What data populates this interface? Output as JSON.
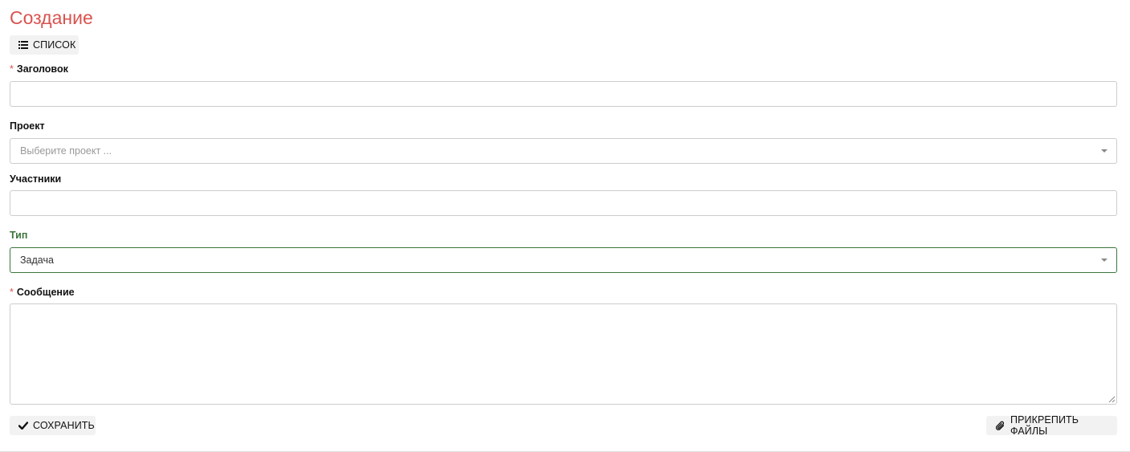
{
  "page": {
    "title": "Создание"
  },
  "toolbar": {
    "list_label": "СПИСОК",
    "list_icon": "list-icon"
  },
  "form": {
    "title_field": {
      "label": "Заголовок",
      "required_mark": "*",
      "value": ""
    },
    "project_field": {
      "label": "Проект",
      "placeholder": "Выберите проект ..."
    },
    "participants_field": {
      "label": "Участники",
      "value": ""
    },
    "type_field": {
      "label": "Тип",
      "selected": "Задача",
      "state_color": "#3c763d"
    },
    "message_field": {
      "label": "Сообщение",
      "required_mark": "*",
      "value": ""
    }
  },
  "actions": {
    "save_label": "СОХРАНИТЬ",
    "save_icon": "check-icon",
    "attach_label": "ПРИКРЕПИТЬ ФАЙЛЫ",
    "attach_icon": "paperclip-icon"
  },
  "colors": {
    "title": "#d9534f",
    "required": "#d9534f",
    "success": "#3c763d",
    "button_bg": "#f2f2f2",
    "border": "#cccccc"
  }
}
